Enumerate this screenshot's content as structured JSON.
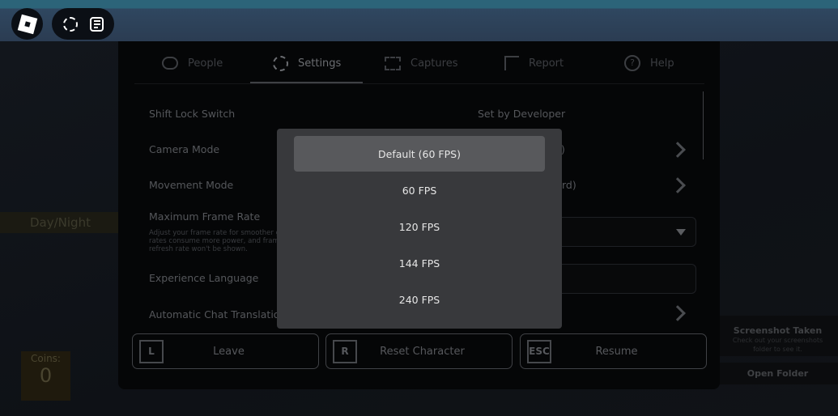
{
  "topbar": {
    "roblox_icon": "roblox-logo-icon",
    "avatar_icon": "avatar-cube-icon",
    "chat_icon": "chat-icon"
  },
  "world": {
    "daynight_label": "Day/Night",
    "coins_label": "Coins:",
    "coins_value": "0"
  },
  "tabs": [
    {
      "label": "People",
      "icon": "people-icon"
    },
    {
      "label": "Settings",
      "icon": "gear-icon",
      "active": true
    },
    {
      "label": "Captures",
      "icon": "camera-icon"
    },
    {
      "label": "Report",
      "icon": "flag-icon"
    },
    {
      "label": "Help",
      "icon": "help-icon"
    }
  ],
  "settings": {
    "shift_lock": {
      "label": "Shift Lock Switch",
      "value": "Set by Developer"
    },
    "camera_mode": {
      "label": "Camera Mode",
      "value_fragment": ")"
    },
    "movement_mode": {
      "label": "Movement Mode",
      "value_fragment": "rd)"
    },
    "max_frame_rate": {
      "label": "Maximum Frame Rate",
      "desc": [
        "Adjust your frame rate for smoother g",
        "rates consume more power, and frame",
        "refresh rate won't be shown."
      ]
    },
    "experience_language": {
      "label": "Experience Language"
    },
    "auto_chat_translation": {
      "label": "Automatic Chat Translation"
    }
  },
  "bottom": [
    {
      "key": "L",
      "label": "Leave"
    },
    {
      "key": "R",
      "label": "Reset Character"
    },
    {
      "key": "ESC",
      "label": "Resume"
    }
  ],
  "dropdown": {
    "options": [
      "Default (60 FPS)",
      "60 FPS",
      "120 FPS",
      "144 FPS",
      "240 FPS"
    ],
    "selected": "Default (60 FPS)"
  },
  "toast": {
    "title": "Screenshot Taken",
    "message": "Check out your screenshots folder to see it.",
    "button": "Open Folder"
  }
}
